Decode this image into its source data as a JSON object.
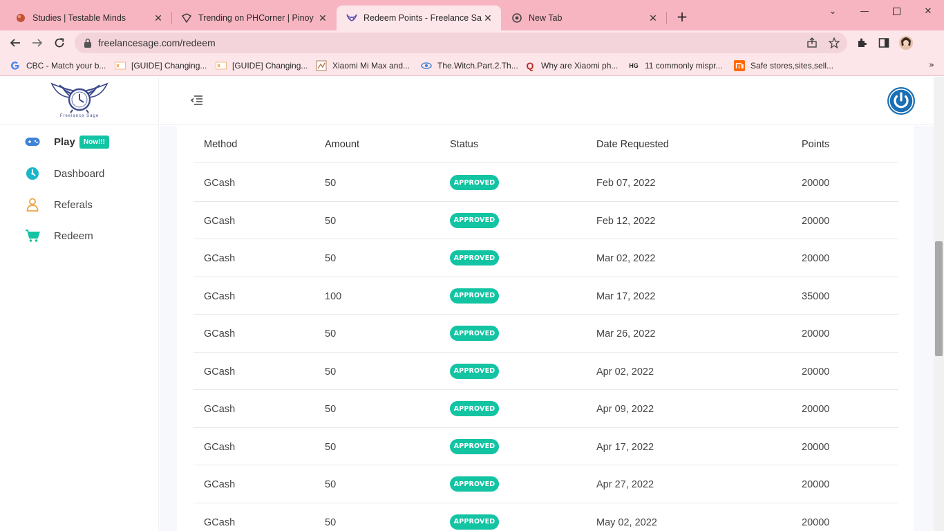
{
  "browser": {
    "tabs": [
      {
        "title": "Studies | Testable Minds",
        "active": false
      },
      {
        "title": "Trending on PHCorner | Pinoy Int",
        "active": false
      },
      {
        "title": "Redeem Points - Freelance Sage",
        "active": true
      },
      {
        "title": "New Tab",
        "active": false
      }
    ],
    "address": "freelancesage.com/redeem",
    "bookmarks": [
      {
        "label": "CBC - Match your b...",
        "icon": "google-icon"
      },
      {
        "label": "[GUIDE] Changing...",
        "icon": "xda-icon"
      },
      {
        "label": "[GUIDE] Changing...",
        "icon": "xda-icon"
      },
      {
        "label": "Xiaomi Mi Max and...",
        "icon": "page-icon"
      },
      {
        "label": "The.Witch.Part.2.Th...",
        "icon": "page-icon"
      },
      {
        "label": "Why are Xiaomi ph...",
        "icon": "quora-icon"
      },
      {
        "label": "11 commonly mispr...",
        "icon": "hg-icon",
        "icon_text": "HG"
      },
      {
        "label": "Safe stores,sites,sell...",
        "icon": "mi-icon"
      }
    ]
  },
  "logo": {
    "text": "Freelance Sage"
  },
  "sidebar": {
    "items": [
      {
        "label": "Play",
        "badge": "Now!!!",
        "icon": "gamepad-icon"
      },
      {
        "label": "Dashboard",
        "icon": "dashboard-icon"
      },
      {
        "label": "Referals",
        "icon": "user-icon"
      },
      {
        "label": "Redeem",
        "icon": "cart-icon"
      }
    ]
  },
  "colors": {
    "accent": "#13c4a3",
    "brand": "#1a6fb5",
    "chrome": "#f6b5c1"
  },
  "table": {
    "columns": [
      "Method",
      "Amount",
      "Status",
      "Date Requested",
      "Points"
    ],
    "rows": [
      {
        "method": "GCash",
        "amount": "50",
        "status": "APPROVED",
        "date": "Feb 07, 2022",
        "points": "20000"
      },
      {
        "method": "GCash",
        "amount": "50",
        "status": "APPROVED",
        "date": "Feb 12, 2022",
        "points": "20000"
      },
      {
        "method": "GCash",
        "amount": "50",
        "status": "APPROVED",
        "date": "Mar 02, 2022",
        "points": "20000"
      },
      {
        "method": "GCash",
        "amount": "100",
        "status": "APPROVED",
        "date": "Mar 17, 2022",
        "points": "35000"
      },
      {
        "method": "GCash",
        "amount": "50",
        "status": "APPROVED",
        "date": "Mar 26, 2022",
        "points": "20000"
      },
      {
        "method": "GCash",
        "amount": "50",
        "status": "APPROVED",
        "date": "Apr 02, 2022",
        "points": "20000"
      },
      {
        "method": "GCash",
        "amount": "50",
        "status": "APPROVED",
        "date": "Apr 09, 2022",
        "points": "20000"
      },
      {
        "method": "GCash",
        "amount": "50",
        "status": "APPROVED",
        "date": "Apr 17, 2022",
        "points": "20000"
      },
      {
        "method": "GCash",
        "amount": "50",
        "status": "APPROVED",
        "date": "Apr 27, 2022",
        "points": "20000"
      },
      {
        "method": "GCash",
        "amount": "50",
        "status": "APPROVED",
        "date": "May 02, 2022",
        "points": "20000"
      }
    ]
  }
}
